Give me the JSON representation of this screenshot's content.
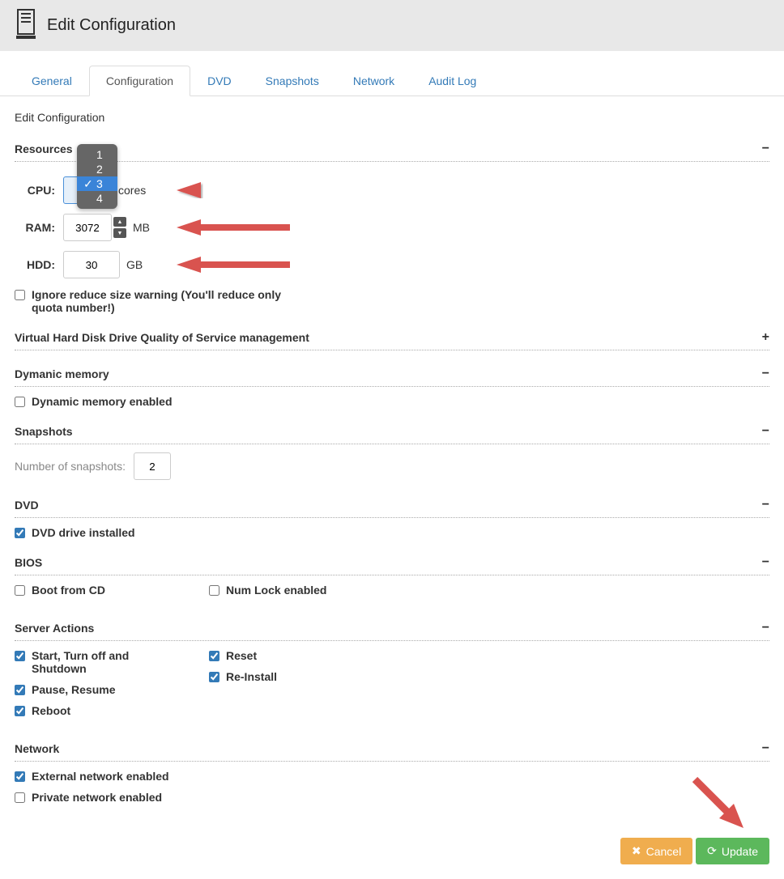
{
  "header": {
    "title": "Edit Configuration"
  },
  "tabs": [
    "General",
    "Configuration",
    "DVD",
    "Snapshots",
    "Network",
    "Audit Log"
  ],
  "active_tab": "Configuration",
  "subtitle": "Edit Configuration",
  "sections": {
    "resources": {
      "title": "Resources",
      "cpu_label": "CPU:",
      "cpu_value": "3",
      "cpu_unit": "cores",
      "cpu_options": [
        "1",
        "2",
        "3",
        "4"
      ],
      "ram_label": "RAM:",
      "ram_value": "3072",
      "ram_unit": "MB",
      "hdd_label": "HDD:",
      "hdd_value": "30",
      "hdd_unit": "GB",
      "ignore_warning": "Ignore reduce size warning (You'll reduce only quota number!)"
    },
    "vhdd_qos": {
      "title": "Virtual Hard Disk Drive Quality of Service management"
    },
    "dynamic_memory": {
      "title": "Dymanic memory",
      "enabled_label": "Dynamic memory enabled"
    },
    "snapshots": {
      "title": "Snapshots",
      "count_label": "Number of snapshots:",
      "count_value": "2"
    },
    "dvd": {
      "title": "DVD",
      "installed_label": "DVD drive installed"
    },
    "bios": {
      "title": "BIOS",
      "boot_cd_label": "Boot from CD",
      "numlock_label": "Num Lock enabled"
    },
    "server_actions": {
      "title": "Server Actions",
      "start_label": "Start, Turn off and Shutdown",
      "reset_label": "Reset",
      "pause_label": "Pause, Resume",
      "reinstall_label": "Re-Install",
      "reboot_label": "Reboot"
    },
    "network": {
      "title": "Network",
      "external_label": "External network enabled",
      "private_label": "Private network enabled"
    }
  },
  "buttons": {
    "cancel": "Cancel",
    "update": "Update"
  }
}
